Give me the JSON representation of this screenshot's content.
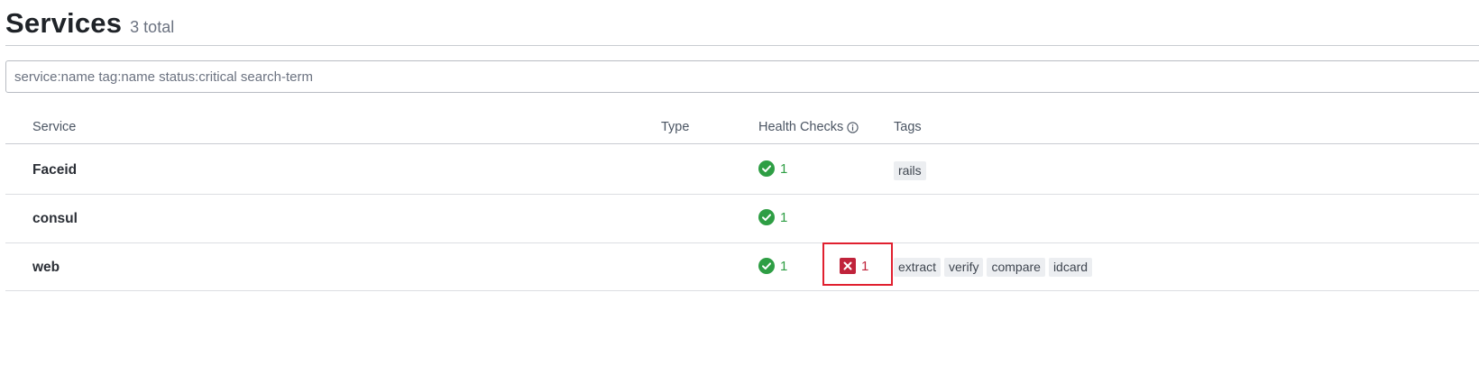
{
  "header": {
    "title": "Services",
    "count": "3 total"
  },
  "search": {
    "placeholder": "service:name tag:name status:critical search-term"
  },
  "table": {
    "columns": {
      "service": "Service",
      "type": "Type",
      "health": "Health Checks",
      "tags": "Tags"
    },
    "rows": [
      {
        "name": "Faceid",
        "type": "",
        "passing": "1",
        "critical": "",
        "tags": [
          "rails"
        ]
      },
      {
        "name": "consul",
        "type": "",
        "passing": "1",
        "critical": "",
        "tags": []
      },
      {
        "name": "web",
        "type": "",
        "passing": "1",
        "critical": "1",
        "tags": [
          "extract",
          "verify",
          "compare",
          "idcard"
        ]
      }
    ]
  },
  "colors": {
    "passing": "#2e9e44",
    "critical": "#c0233b",
    "highlight": "#e0202f"
  },
  "icons": {
    "passing": "check-circle-icon",
    "critical": "x-square-icon",
    "info": "info-circle-icon"
  }
}
